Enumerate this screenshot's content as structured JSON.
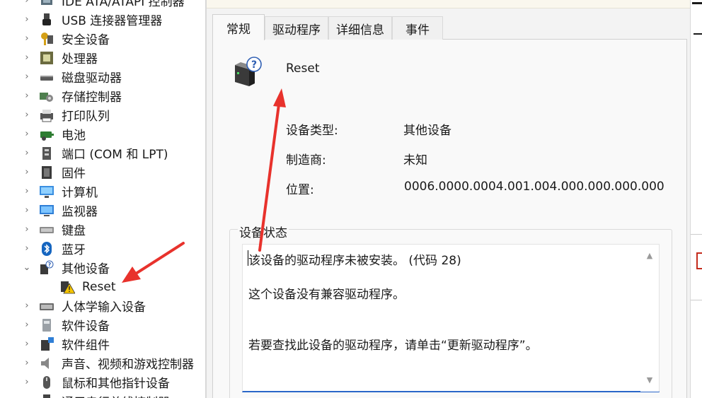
{
  "device_tree": {
    "items": [
      {
        "label": "IDE ATA/ATAPI 控制器",
        "icon": "ide-controller-icon",
        "expanded": false
      },
      {
        "label": "USB 连接器管理器",
        "icon": "usb-icon",
        "expanded": false
      },
      {
        "label": "安全设备",
        "icon": "security-key-icon",
        "expanded": false
      },
      {
        "label": "处理器",
        "icon": "processor-icon",
        "expanded": false
      },
      {
        "label": "磁盘驱动器",
        "icon": "disk-drive-icon",
        "expanded": false
      },
      {
        "label": "存储控制器",
        "icon": "storage-controller-icon",
        "expanded": false
      },
      {
        "label": "打印队列",
        "icon": "printer-icon",
        "expanded": false
      },
      {
        "label": "电池",
        "icon": "battery-icon",
        "expanded": false
      },
      {
        "label": "端口 (COM 和 LPT)",
        "icon": "port-icon",
        "expanded": false
      },
      {
        "label": "固件",
        "icon": "firmware-icon",
        "expanded": false
      },
      {
        "label": "计算机",
        "icon": "computer-icon",
        "expanded": false
      },
      {
        "label": "监视器",
        "icon": "monitor-icon",
        "expanded": false
      },
      {
        "label": "键盘",
        "icon": "keyboard-icon",
        "expanded": false
      },
      {
        "label": "蓝牙",
        "icon": "bluetooth-icon",
        "expanded": false
      },
      {
        "label": "其他设备",
        "icon": "unknown-device-icon",
        "expanded": true
      },
      {
        "label": "Reset",
        "icon": "warning-device-icon",
        "child": true
      },
      {
        "label": "人体学输入设备",
        "icon": "hid-icon",
        "expanded": false
      },
      {
        "label": "软件设备",
        "icon": "software-device-icon",
        "expanded": false
      },
      {
        "label": "软件组件",
        "icon": "software-component-icon",
        "expanded": false
      },
      {
        "label": "声音、视频和游戏控制器",
        "icon": "speaker-icon",
        "expanded": false
      },
      {
        "label": "鼠标和其他指针设备",
        "icon": "mouse-icon",
        "expanded": false
      },
      {
        "label": "通用串行总线控制器",
        "icon": "usb-controller-icon",
        "expanded": false
      }
    ]
  },
  "dialog": {
    "tabs": [
      {
        "label": "常规",
        "active": true
      },
      {
        "label": "驱动程序",
        "active": false
      },
      {
        "label": "详细信息",
        "active": false
      },
      {
        "label": "事件",
        "active": false
      }
    ],
    "device_name": "Reset",
    "properties": {
      "type_label": "设备类型:",
      "type_value": "其他设备",
      "manufacturer_label": "制造商:",
      "manufacturer_value": "未知",
      "location_label": "位置:",
      "location_value": "0006.0000.0004.001.004.000.000.000.000"
    },
    "status": {
      "legend": "设备状态",
      "line1": "该设备的驱动程序未被安装。 (代码 28)",
      "line2": "这个设备没有兼容驱动程序。",
      "line3": "若要查找此设备的驱动程序，请单击“更新驱动程序”。"
    }
  },
  "colors": {
    "arrow": "#e8322c",
    "accent": "#2a66c8",
    "warning": "#f5c400"
  }
}
